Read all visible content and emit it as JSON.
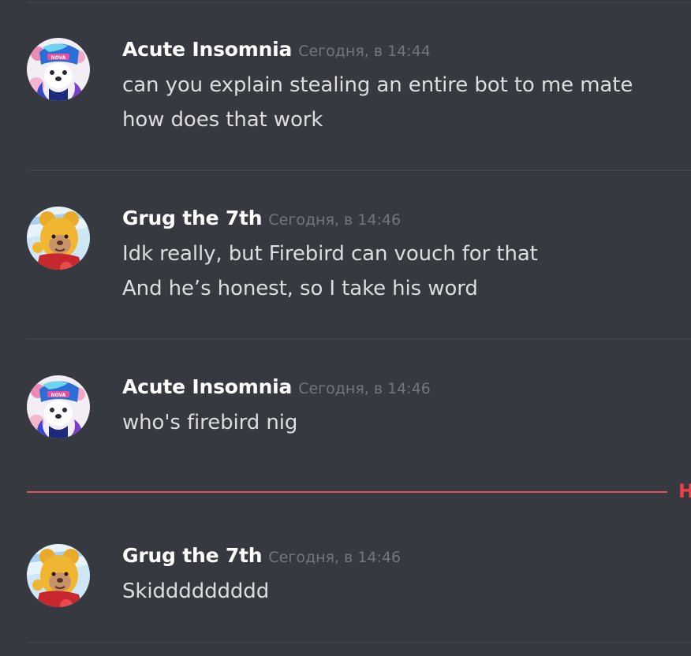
{
  "messages": [
    {
      "author": "Acute Insomnia",
      "timestamp": "Сегодня, в 14:44",
      "lines": [
        "can you explain stealing an entire bot to me mate",
        "how does that work"
      ]
    },
    {
      "author": "Grug the 7th",
      "timestamp": "Сегодня, в 14:46",
      "lines": [
        "Idk really, but Firebird can vouch for that",
        "And he’s honest, so I take his word"
      ]
    },
    {
      "author": "Acute Insomnia",
      "timestamp": "Сегодня, в 14:46",
      "lines": [
        "who's firebird nig"
      ]
    },
    {
      "author": "Grug the 7th",
      "timestamp": "Сегодня, в 14:46",
      "lines": [
        "Skiddddddddd"
      ]
    }
  ],
  "new_messages_divider": {
    "label": "Н",
    "color": "#ed4245"
  },
  "avatars": {
    "acute_insomnia": {
      "icon": "anime-fox-avatar-icon",
      "badge_text": "NOVA"
    },
    "grug": {
      "icon": "winnie-pooh-avatar-icon"
    }
  },
  "colors": {
    "background": "#36393f",
    "username": "#ffffff",
    "timestamp": "#72767d",
    "text": "#dcddde",
    "new_divider": "#ed4245"
  }
}
